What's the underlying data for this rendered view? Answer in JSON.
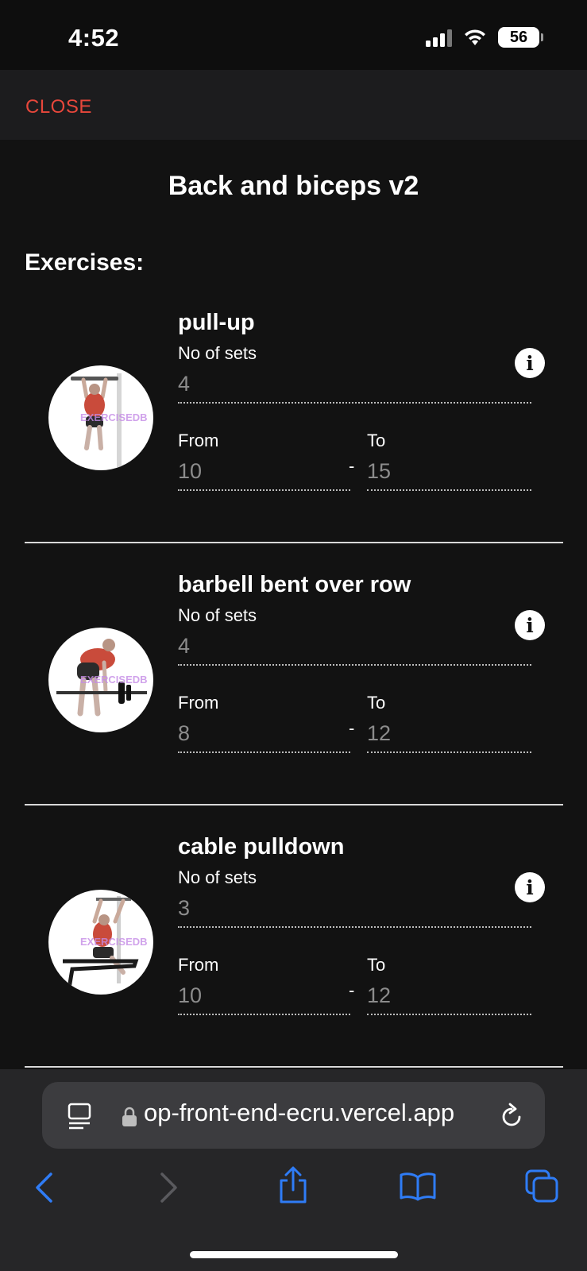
{
  "status_bar": {
    "time": "4:52",
    "battery": "56"
  },
  "header": {
    "close_label": "CLOSE"
  },
  "workout": {
    "title": "Back and biceps v2",
    "section_heading": "Exercises:"
  },
  "labels": {
    "sets": "No of sets",
    "from": "From",
    "to": "To",
    "separator": "-"
  },
  "exercises": [
    {
      "name": "pull-up",
      "sets": "4",
      "from": "10",
      "to": "15"
    },
    {
      "name": "barbell bent over row",
      "sets": "4",
      "from": "8",
      "to": "12"
    },
    {
      "name": "cable pulldown",
      "sets": "3",
      "from": "10",
      "to": "12"
    }
  ],
  "browser": {
    "url": "workout-app-front-end-ecru.vercel.app",
    "url_visible": "op-front-end-ecru.vercel.app"
  },
  "colors": {
    "accent": "#e8473b",
    "background": "#121212",
    "link_blue": "#2f7cf6"
  }
}
